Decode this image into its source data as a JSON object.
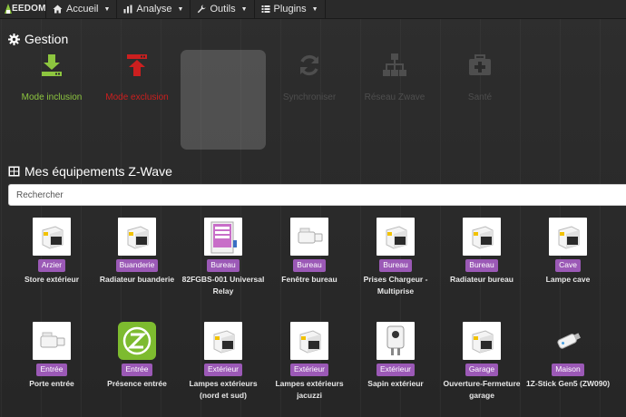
{
  "navbar": {
    "logo_text": "EEDOM",
    "items": [
      {
        "label": "Accueil",
        "icon": "home-icon"
      },
      {
        "label": "Analyse",
        "icon": "bar-chart-icon"
      },
      {
        "label": "Outils",
        "icon": "wrench-icon"
      },
      {
        "label": "Plugins",
        "icon": "list-icon"
      }
    ]
  },
  "gestion": {
    "title": "Gestion",
    "actions": [
      {
        "label": "Mode inclusion",
        "icon": "download-icon",
        "color": "#8dc63f"
      },
      {
        "label": "Mode exclusion",
        "icon": "upload-icon",
        "color": "#cc1f1f"
      },
      {
        "label": "",
        "icon": "",
        "color": ""
      },
      {
        "label": "Synchroniser",
        "icon": "refresh-icon",
        "color": "#555555"
      },
      {
        "label": "Réseau Zwave",
        "icon": "network-icon",
        "color": "#555555"
      },
      {
        "label": "Santé",
        "icon": "medkit-icon",
        "color": "#555555"
      }
    ]
  },
  "equipments": {
    "title": "Mes équipements Z-Wave",
    "search_placeholder": "Rechercher",
    "items": [
      {
        "room": "Arzier",
        "name": "Store extérieur",
        "name2": "",
        "icon": "fibaro-module-icon"
      },
      {
        "room": "Buanderie",
        "name": "Radiateur buanderie",
        "name2": "",
        "icon": "fibaro-module-icon"
      },
      {
        "room": "Bureau",
        "name": "82FGBS-001 Universal",
        "name2": "Relay",
        "icon": "universal-sensor-box-icon"
      },
      {
        "room": "Bureau",
        "name": "Fenêtre bureau",
        "name2": "",
        "icon": "door-sensor-icon"
      },
      {
        "room": "Bureau",
        "name": "Prises Chargeur -",
        "name2": "Multiprise",
        "icon": "fibaro-module-icon"
      },
      {
        "room": "Bureau",
        "name": "Radiateur bureau",
        "name2": "",
        "icon": "fibaro-module-icon"
      },
      {
        "room": "Cave",
        "name": "Lampe cave",
        "name2": "",
        "icon": "fibaro-module-icon"
      },
      {
        "room": "Entrée",
        "name": "Porte entrée",
        "name2": "",
        "icon": "door-sensor-icon"
      },
      {
        "room": "Entrée",
        "name": "Présence entrée",
        "name2": "",
        "icon": "presence-z-icon"
      },
      {
        "room": "Extérieur",
        "name": "Lampes extérieurs",
        "name2": "(nord et sud)",
        "icon": "fibaro-module-icon"
      },
      {
        "room": "Extérieur",
        "name": "Lampes extérieurs",
        "name2": "jacuzzi",
        "icon": "fibaro-module-icon"
      },
      {
        "room": "Extérieur",
        "name": "Sapin extérieur",
        "name2": "",
        "icon": "wall-plug-icon"
      },
      {
        "room": "Garage",
        "name": "Ouverture-Fermeture",
        "name2": "garage",
        "icon": "fibaro-module-icon"
      },
      {
        "room": "Maison",
        "name": "1Z-Stick Gen5 (ZW090)",
        "name2": "",
        "icon": "usb-stick-icon"
      }
    ]
  },
  "colors": {
    "badge": "#9b59b6",
    "inclusion": "#8dc63f",
    "exclusion": "#cc1f1f"
  }
}
